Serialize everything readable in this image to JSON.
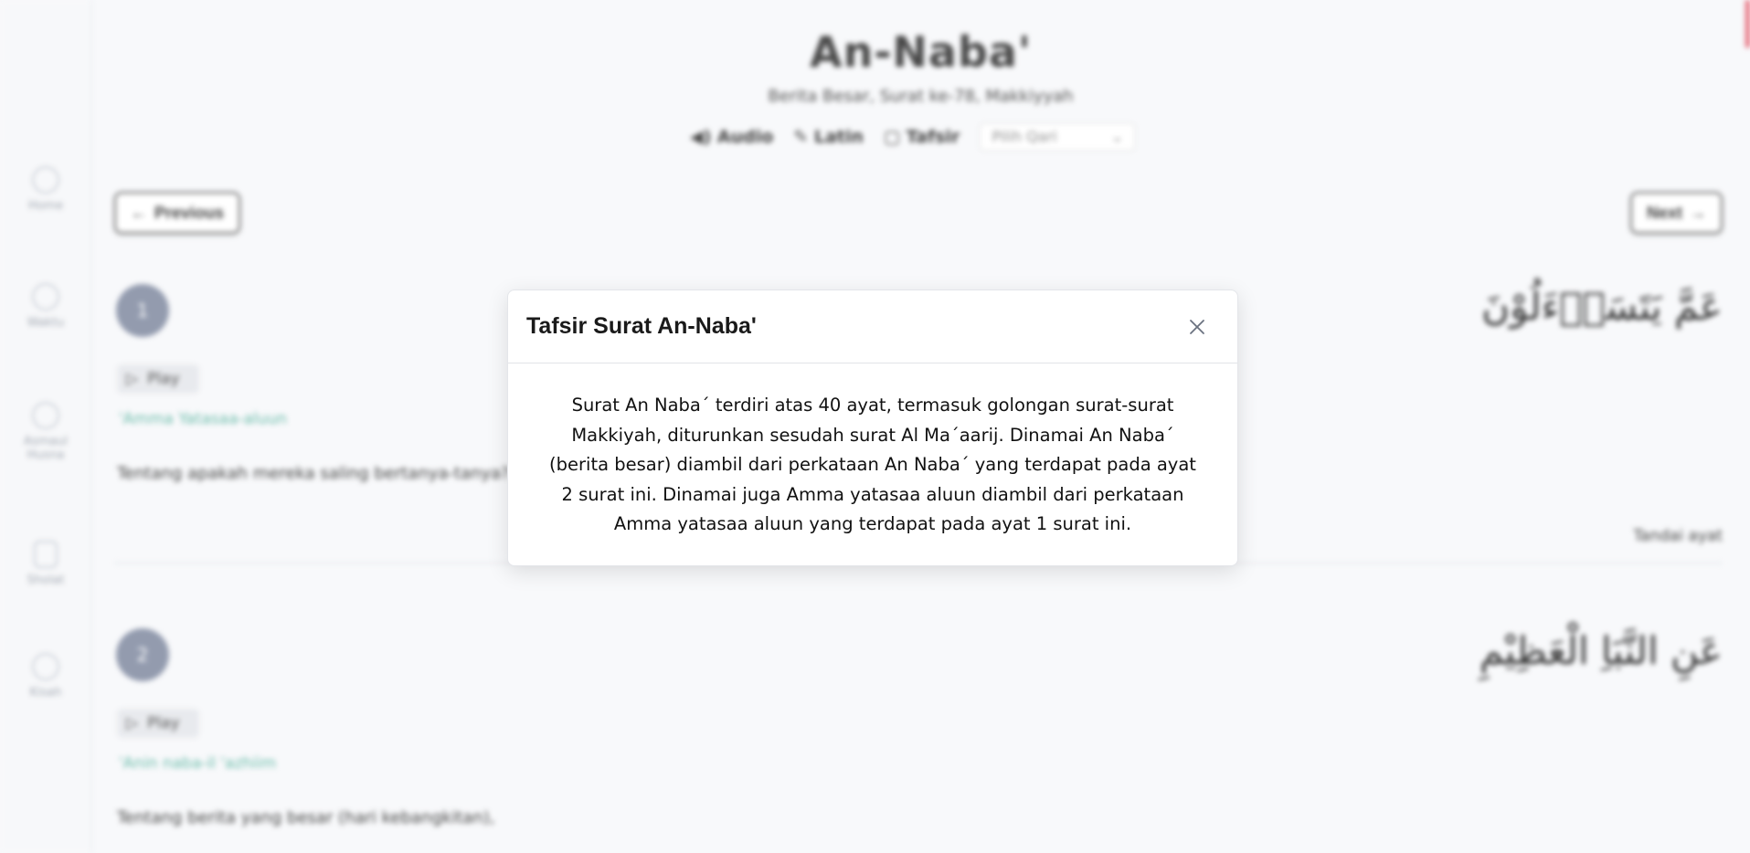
{
  "sidebar": {
    "items": [
      {
        "label": "Home",
        "icon": "home-icon"
      },
      {
        "label": "Waktu",
        "icon": "clock-icon"
      },
      {
        "label": "Asmaul Husna",
        "icon": "star-icon"
      },
      {
        "label": "Sholat",
        "icon": "book-icon"
      },
      {
        "label": "Kisah",
        "icon": "pen-icon"
      }
    ]
  },
  "surah": {
    "title": "An-Naba'",
    "subtitle": "Berita Besar, Surat ke-78, Makkiyyah",
    "audio_label": "Audio",
    "latin_label": "Latin",
    "tafsir_label": "Tafsir",
    "qari_placeholder": "Pilih Qari",
    "prev_label": "Previous",
    "next_label": "Next"
  },
  "verses": [
    {
      "number": "1",
      "arabic": "عَمَّ يَتَسَاۤءَلُوْنَ",
      "play_label": "Play",
      "latin": "'Amma Yatasaa-aluun",
      "translation": "Tentang apakah mereka saling bertanya-tanya?",
      "mark_label": "Tandai ayat"
    },
    {
      "number": "2",
      "arabic": "عَنِ النَّبَاِ الْعَظِيْمِ",
      "play_label": "Play",
      "latin": "'Anin naba-il 'azhiim",
      "translation": "Tentang berita yang besar (hari kebangkitan),",
      "mark_label": ""
    }
  ],
  "modal": {
    "title": "Tafsir Surat An-Naba'",
    "body": "Surat An Naba´ terdiri atas 40 ayat, termasuk golongan surat-surat Makkiyah, diturunkan sesudah surat Al Ma´aarij. Dinamai An Naba´ (berita besar) diambil dari perkataan An Naba´ yang terdapat pada ayat 2 surat ini. Dinamai juga Amma yatasaa aluun diambil dari perkataan Amma yatasaa aluun yang terdapat pada ayat 1 surat ini."
  },
  "colors": {
    "accent": "#e45a6b",
    "latin_text": "#5fb6a4",
    "verse_badge": "#8a93a8"
  }
}
